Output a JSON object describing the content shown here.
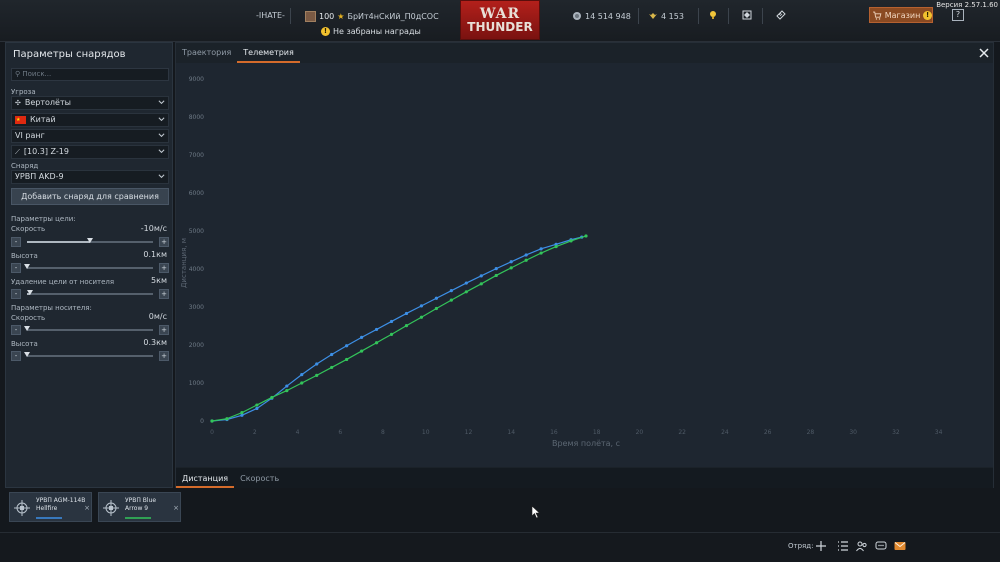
{
  "version": "Версия 2.57.1.60",
  "topbar": {
    "nick_left": "-IHATE-",
    "level": "100",
    "nickname": "БрИт4нСкИй_П0дСОС",
    "logo_line1": "WAR",
    "logo_line2": "THUNDER",
    "silver_lions": "14 514 948",
    "golden_eagles": "4 153",
    "rewards_notice": "Не забраны награды",
    "shop_label": "Магазин",
    "help_label": "?"
  },
  "sidebar": {
    "title": "Параметры снарядов",
    "search_placeholder": "Поиск...",
    "threat_label": "Угроза",
    "threat_type": "Вертолёты",
    "country": "Китай",
    "rank": "VI ранг",
    "vehicle": "[10.3] Z-19",
    "shell_label": "Снаряд",
    "shell": "УРВП AKD-9",
    "add_button": "Добавить снаряд для сравнения",
    "target_params_label": "Параметры цели:",
    "target_speed_label": "Скорость",
    "target_speed_value": "-10м/с",
    "target_speed_level": 0.5,
    "target_alt_label": "Высота",
    "target_alt_value": "0.1км",
    "target_alt_level": 0.0,
    "target_dist_label": "Удаление цели от носителя",
    "target_dist_value": "5км",
    "target_dist_level": 0.02,
    "carrier_params_label": "Параметры носителя:",
    "carrier_speed_label": "Скорость",
    "carrier_speed_value": "0м/с",
    "carrier_speed_level": 0.0,
    "carrier_alt_label": "Высота",
    "carrier_alt_value": "0.3км",
    "carrier_alt_level": 0.0,
    "minus": "-",
    "plus": "+"
  },
  "main": {
    "tabs": [
      "Траектория",
      "Телеметрия"
    ],
    "bottom_tabs": [
      "Дистанция",
      "Скорость"
    ]
  },
  "compare": {
    "cards": [
      {
        "name": "УРВП AGM-114B Hellfire",
        "color": "#3d8fe6"
      },
      {
        "name": "УРВП Blue Arrow 9",
        "color": "#33c45a"
      }
    ],
    "close": "×"
  },
  "bottombar": {
    "squad_label": "Отряд:"
  },
  "colors": {
    "accent": "#d46b2b",
    "series_blue": "#3d8fe6",
    "series_green": "#33c45a"
  },
  "chart_data": {
    "type": "line",
    "xlabel": "Время полёта, с",
    "ylabel": "Дистанция, м",
    "xlim": [
      0,
      35
    ],
    "ylim": [
      0,
      9000
    ],
    "xticks": [
      0,
      2,
      4,
      6,
      8,
      10,
      12,
      14,
      16,
      18,
      20,
      22,
      24,
      26,
      28,
      30,
      32,
      34
    ],
    "yticks": [
      0,
      1000,
      2000,
      3000,
      4000,
      5000,
      6000,
      7000,
      8000,
      9000
    ],
    "series": [
      {
        "name": "УРВП AGM-114B Hellfire",
        "color": "#3d8fe6",
        "x": [
          0,
          0.7,
          1.4,
          2.1,
          2.8,
          3.5,
          4.2,
          4.9,
          5.6,
          6.3,
          7.0,
          7.7,
          8.4,
          9.1,
          9.8,
          10.5,
          11.2,
          11.9,
          12.6,
          13.3,
          14.0,
          14.7,
          15.4,
          16.1,
          16.8,
          17.3
        ],
        "y": [
          0,
          40,
          150,
          330,
          600,
          920,
          1220,
          1500,
          1750,
          1980,
          2200,
          2410,
          2620,
          2830,
          3030,
          3230,
          3430,
          3630,
          3820,
          4010,
          4190,
          4370,
          4530,
          4650,
          4770,
          4840
        ]
      },
      {
        "name": "УРВП Blue Arrow 9",
        "color": "#33c45a",
        "x": [
          0,
          0.7,
          1.4,
          2.1,
          2.8,
          3.5,
          4.2,
          4.9,
          5.6,
          6.3,
          7.0,
          7.7,
          8.4,
          9.1,
          9.8,
          10.5,
          11.2,
          11.9,
          12.6,
          13.3,
          14.0,
          14.7,
          15.4,
          16.1,
          16.8,
          17.5
        ],
        "y": [
          0,
          60,
          220,
          420,
          620,
          800,
          1000,
          1200,
          1410,
          1620,
          1840,
          2060,
          2280,
          2510,
          2730,
          2960,
          3180,
          3400,
          3610,
          3830,
          4030,
          4230,
          4420,
          4590,
          4740,
          4870
        ]
      }
    ]
  }
}
